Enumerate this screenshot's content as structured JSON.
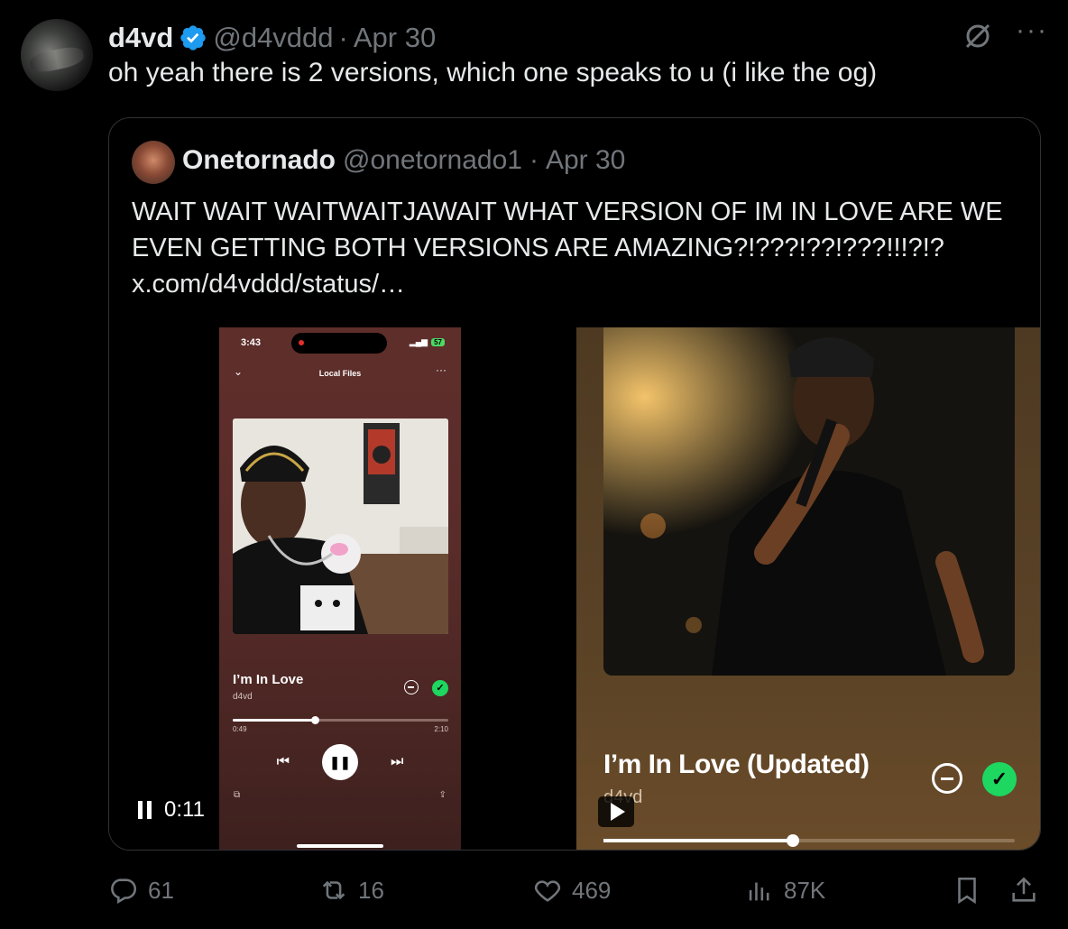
{
  "tweet": {
    "author_name": "d4vd",
    "author_handle": "@d4vddd",
    "separator": "·",
    "date": "Apr 30",
    "text": "oh yeah there is 2 versions, which one speaks to u (i like the og)",
    "more_label": "···"
  },
  "quote": {
    "author_name": "Onetornado",
    "author_handle": "@onetornado1",
    "separator": "·",
    "date": "Apr 30",
    "lines": [
      "WAIT WAIT WAITWAITJAWAIT WHAT VERSION OF IM IN LOVE ARE WE",
      "EVEN GETTING BOTH VERSIONS ARE AMAZING?!???!??!???!!!?!?",
      "x.com/d4vddd/status/…"
    ]
  },
  "phone": {
    "time": "3:43",
    "battery": "57",
    "header": "Local Files",
    "song_title": "I’m In Love",
    "artist": "d4vd",
    "elapsed": "0:49",
    "duration": "2:10",
    "progress": 0.38
  },
  "video": {
    "time": "0:11"
  },
  "right_photo": {
    "song_title": "I’m In Love (Updated)",
    "artist": "d4vd",
    "progress": 0.46
  },
  "actions": {
    "replies": "61",
    "reposts": "16",
    "likes": "469",
    "views": "87K"
  },
  "colors": {
    "background": "#000000",
    "text": "#e7e9ea",
    "muted": "#71767b",
    "verified": "#1d9bf0",
    "spotify_green": "#1ed760"
  }
}
